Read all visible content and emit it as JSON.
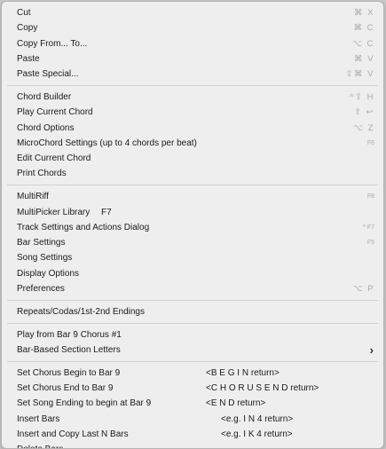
{
  "sections": [
    [
      {
        "label": "Cut",
        "shortcut": "⌘ X"
      },
      {
        "label": "Copy",
        "shortcut": "⌘ C"
      },
      {
        "label": "Copy From... To...",
        "shortcut": "⌥ C"
      },
      {
        "label": "Paste",
        "shortcut": "⌘ V"
      },
      {
        "label": "Paste Special...",
        "shortcut": "⇧⌘ V"
      }
    ],
    [
      {
        "label": "Chord Builder",
        "shortcut": "^⇧ H"
      },
      {
        "label": "Play Current Chord",
        "shortcut": "⇧ ↩"
      },
      {
        "label": "Chord Options",
        "shortcut": "⌥ Z"
      },
      {
        "label": "MicroChord Settings (up to 4 chords per beat)",
        "shortcut": "F6"
      },
      {
        "label": "Edit Current Chord",
        "shortcut": ""
      },
      {
        "label": "Print Chords",
        "shortcut": ""
      }
    ],
    [
      {
        "label": "MultiRiff",
        "shortcut": "F8"
      },
      {
        "label": "MultiPicker Library",
        "extra": "F7",
        "shortcut": ""
      },
      {
        "label": "Track Settings and Actions Dialog",
        "shortcut": "^ F7"
      },
      {
        "label": "Bar Settings",
        "shortcut": "F5"
      },
      {
        "label": "Song Settings",
        "shortcut": ""
      },
      {
        "label": "Display Options",
        "shortcut": ""
      },
      {
        "label": "Preferences",
        "shortcut": "⌥ P"
      }
    ],
    [
      {
        "label": "Repeats/Codas/1st-2nd Endings",
        "shortcut": ""
      }
    ],
    [
      {
        "label": "Play from Bar 9 Chorus #1",
        "shortcut": ""
      },
      {
        "label": "Bar-Based Section Letters",
        "shortcut": "",
        "submenu": "›"
      }
    ],
    [
      {
        "label": "Set Chorus Begin to Bar 9",
        "extra": "<B E G I N return>",
        "shortcut": ""
      },
      {
        "label": "Set Chorus End to Bar 9",
        "extra": "<C H O R U S E N D return>",
        "shortcut": ""
      },
      {
        "label": "Set Song Ending to begin at Bar 9",
        "extra": "<E N D return>",
        "shortcut": ""
      },
      {
        "label": "Insert Bars",
        "extra": "<e.g. I N 4 return>",
        "shortcut": ""
      },
      {
        "label": "Insert and Copy Last N Bars",
        "extra": "<e.g. I K 4 return>",
        "shortcut": ""
      },
      {
        "label": "Delete Bars",
        "shortcut": ""
      }
    ]
  ]
}
